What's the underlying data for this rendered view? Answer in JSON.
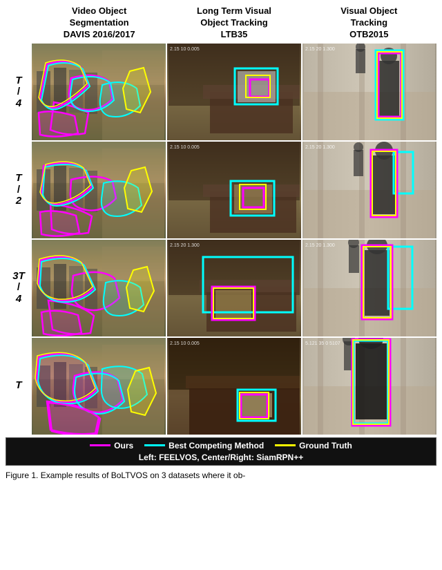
{
  "columns": [
    {
      "id": "vos",
      "header_line1": "Video Object",
      "header_line2": "Segmentation",
      "header_line3": "DAVIS 2016/2017"
    },
    {
      "id": "ltb",
      "header_line1": "Long Term Visual",
      "header_line2": "Object Tracking",
      "header_line3": "LTB35"
    },
    {
      "id": "otb",
      "header_line1": "Visual Object",
      "header_line2": "Tracking",
      "header_line3": "OTB2015"
    }
  ],
  "rows": [
    {
      "label_frac": "T",
      "label_denom": "4",
      "label_display": "T\n/\n4"
    },
    {
      "label_frac": "T",
      "label_denom": "2",
      "label_display": "T\n/\n2"
    },
    {
      "label_frac": "3T",
      "label_denom": "4",
      "label_display": "3T\n/\n4"
    },
    {
      "label_frac": "T",
      "label_denom": "",
      "label_display": "T"
    }
  ],
  "legend": {
    "items": [
      {
        "id": "ours",
        "color": "magenta",
        "label": "Ours"
      },
      {
        "id": "best",
        "color": "cyan",
        "label": "Best Competing Method"
      },
      {
        "id": "gt",
        "color": "yellow",
        "label": "Ground Truth"
      }
    ],
    "subtitle": "Left: FEELVOS, Center/Right: SiamRPN++"
  },
  "caption": "Figure 1. Example results of BoLTVOS on 3 datasets where it ob-"
}
